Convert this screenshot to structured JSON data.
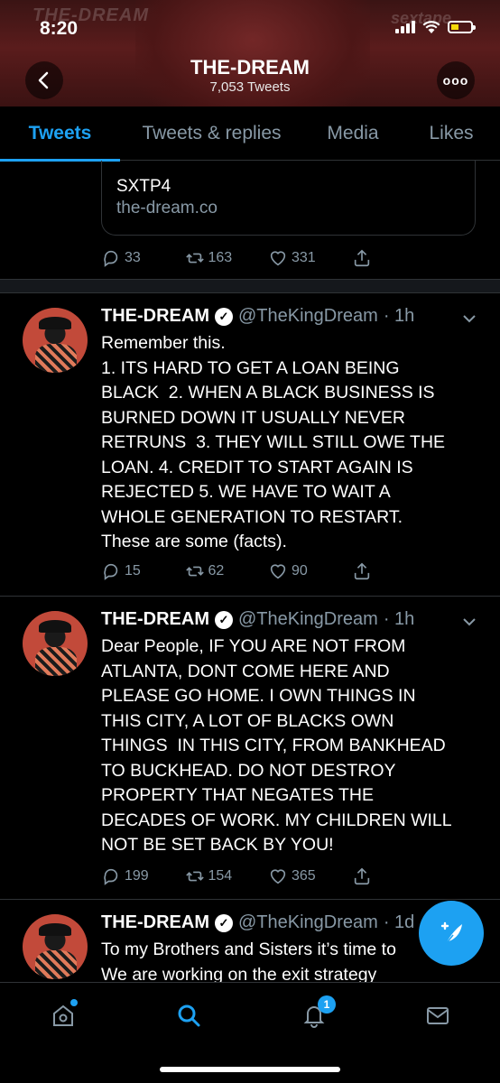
{
  "status": {
    "time": "8:20"
  },
  "header": {
    "name": "THE-DREAM",
    "tweet_count": "7,053 Tweets",
    "more_label": "ooo"
  },
  "tabs": [
    {
      "label": "Tweets",
      "active": true
    },
    {
      "label": "Tweets & replies",
      "active": false
    },
    {
      "label": "Media",
      "active": false
    },
    {
      "label": "Likes",
      "active": false
    }
  ],
  "pinned_link": {
    "title": "SXTP4",
    "url": "the-dream.co",
    "replies": "33",
    "retweets": "163",
    "likes": "331"
  },
  "tweets": [
    {
      "name": "THE-DREAM",
      "handle": "@TheKingDream",
      "time": "· 1h",
      "text": "Remember this.\n1. ITS HARD TO GET A LOAN BEING\nBLACK  2. WHEN A BLACK BUSINESS IS\nBURNED DOWN IT USUALLY NEVER\nRETRUNS  3. THEY WILL STILL OWE THE\nLOAN. 4. CREDIT TO START AGAIN IS\nREJECTED 5. WE HAVE TO WAIT A\nWHOLE GENERATION TO RESTART.\nThese are some (facts).",
      "replies": "15",
      "retweets": "62",
      "likes": "90"
    },
    {
      "name": "THE-DREAM",
      "handle": "@TheKingDream",
      "time": "· 1h",
      "text": "Dear People, IF YOU ARE NOT FROM\nATLANTA, DONT COME HERE AND\nPLEASE GO HOME. I OWN THINGS IN\nTHIS CITY, A LOT OF BLACKS OWN\nTHINGS  IN THIS CITY, FROM BANKHEAD\nTO BUCKHEAD. DO NOT DESTROY\nPROPERTY THAT NEGATES THE\nDECADES OF WORK. MY CHILDREN WILL\nNOT BE SET BACK BY YOU!",
      "replies": "199",
      "retweets": "154",
      "likes": "365"
    },
    {
      "name": "THE-DREAM",
      "handle": "@TheKingDream",
      "time": "· 1d",
      "text": "To my Brothers and Sisters it’s time to\nWe are working on the exit strategy"
    }
  ],
  "bottom_nav": {
    "notifications_badge": "1"
  },
  "colors": {
    "accent": "#1da1f2",
    "muted": "#8899a6",
    "divider": "#2f3336"
  }
}
